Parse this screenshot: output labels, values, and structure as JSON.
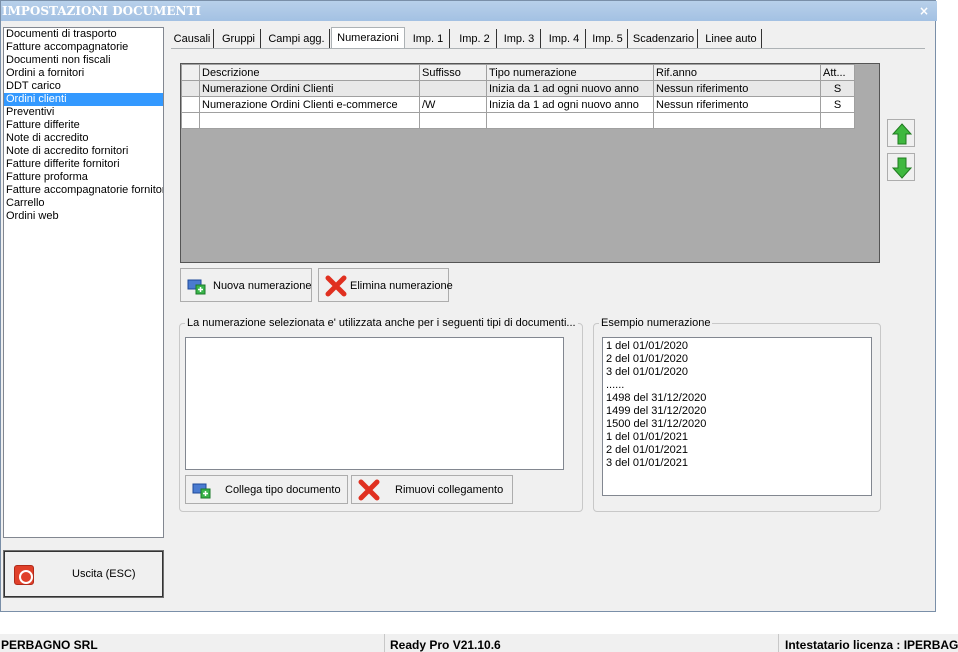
{
  "window": {
    "title": "IMPOSTAZIONI DOCUMENTI",
    "close_glyph": "×"
  },
  "doc_types": [
    {
      "label": "Documenti di trasporto",
      "selected": false
    },
    {
      "label": "Fatture accompagnatorie",
      "selected": false
    },
    {
      "label": "Documenti non fiscali",
      "selected": false
    },
    {
      "label": "Ordini a fornitori",
      "selected": false
    },
    {
      "label": "DDT carico",
      "selected": false
    },
    {
      "label": "Ordini clienti",
      "selected": true
    },
    {
      "label": "Preventivi",
      "selected": false
    },
    {
      "label": "Fatture differite",
      "selected": false
    },
    {
      "label": "Note di accredito",
      "selected": false
    },
    {
      "label": "Note di accredito fornitori",
      "selected": false
    },
    {
      "label": "Fatture differite fornitori",
      "selected": false
    },
    {
      "label": "Fatture proforma",
      "selected": false
    },
    {
      "label": "Fatture accompagnatorie fornitori",
      "selected": false
    },
    {
      "label": "Carrello",
      "selected": false
    },
    {
      "label": "Ordini web",
      "selected": false
    }
  ],
  "exit_button": {
    "label": "Uscita (ESC)",
    "icon": "power-icon"
  },
  "tabs": [
    {
      "label": "Causali",
      "active": false
    },
    {
      "label": "Gruppi",
      "active": false
    },
    {
      "label": "Campi agg.",
      "active": false
    },
    {
      "label": "Numerazioni",
      "active": true
    },
    {
      "label": "Imp. 1",
      "active": false
    },
    {
      "label": "Imp. 2",
      "active": false
    },
    {
      "label": "Imp. 3",
      "active": false
    },
    {
      "label": "Imp. 4",
      "active": false
    },
    {
      "label": "Imp. 5",
      "active": false
    },
    {
      "label": "Scadenzario",
      "active": false
    },
    {
      "label": "Linee auto",
      "active": false
    }
  ],
  "grid": {
    "columns": [
      "Descrizione",
      "Suffisso",
      "Tipo numerazione",
      "Rif.anno",
      "Att..."
    ],
    "rows": [
      {
        "descrizione": "Numerazione Ordini Clienti",
        "suffisso": "",
        "tipo": "Inizia da 1 ad ogni nuovo anno",
        "rif": "Nessun riferimento",
        "att": "S"
      },
      {
        "descrizione": "Numerazione Ordini Clienti e-commerce",
        "suffisso": "/W",
        "tipo": "Inizia da 1 ad ogni nuovo anno",
        "rif": "Nessun riferimento",
        "att": "S"
      }
    ]
  },
  "move_buttons": {
    "up_icon": "arrow-up-icon",
    "down_icon": "arrow-down-icon"
  },
  "actions": {
    "new_label": "Nuova numerazione",
    "delete_label": "Elimina numerazione"
  },
  "linked_group": {
    "legend": "La numerazione selezionata e' utilizzata anche per i seguenti tipi di documenti...",
    "link_label": "Collega tipo documento",
    "unlink_label": "Rimuovi collegamento"
  },
  "example_group": {
    "legend": "Esempio numerazione",
    "lines": [
      "1 del 01/01/2020",
      "2 del 01/01/2020",
      "3 del 01/01/2020",
      "......",
      "1498 del 31/12/2020",
      "1499 del 31/12/2020",
      "1500 del 31/12/2020",
      "1 del 01/01/2021",
      "2 del 01/01/2021",
      "3 del 01/01/2021"
    ]
  },
  "statusbar": {
    "company": "PERBAGNO SRL",
    "version": "Ready Pro V21.10.6",
    "license": "Intestatario licenza : IPERBAGNO"
  },
  "colors": {
    "selection": "#3399ff",
    "title_bg": "#a3c1e3",
    "grid_bg": "#ababab"
  }
}
